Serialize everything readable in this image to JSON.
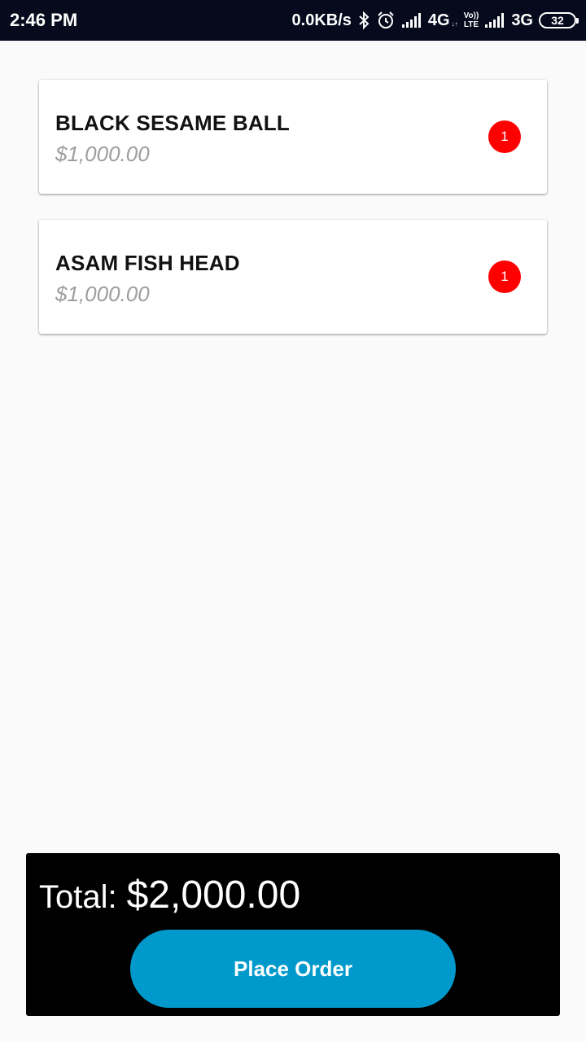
{
  "status_bar": {
    "time": "2:46 PM",
    "net_speed": "0.0KB/s",
    "net1": "4G",
    "net1_small": "↓↑",
    "volte_top": "Vo))",
    "volte_bottom": "LTE",
    "net2": "3G",
    "battery": "32",
    "icons": [
      "bluetooth-icon",
      "alarm-icon",
      "signal-icon",
      "signal-icon",
      "battery-icon"
    ]
  },
  "cart": {
    "items": [
      {
        "name": "BLACK SESAME BALL",
        "price": "$1,000.00",
        "quantity": "1"
      },
      {
        "name": "ASAM FISH HEAD",
        "price": "$1,000.00",
        "quantity": "1"
      }
    ]
  },
  "footer": {
    "total_label": "Total:",
    "total_value": "$2,000.00",
    "place_order_label": "Place Order"
  },
  "colors": {
    "status_bar_bg": "#050a1c",
    "page_bg": "#fafafa",
    "badge": "#ff0000",
    "button": "#0099cc",
    "panel": "#000000"
  }
}
